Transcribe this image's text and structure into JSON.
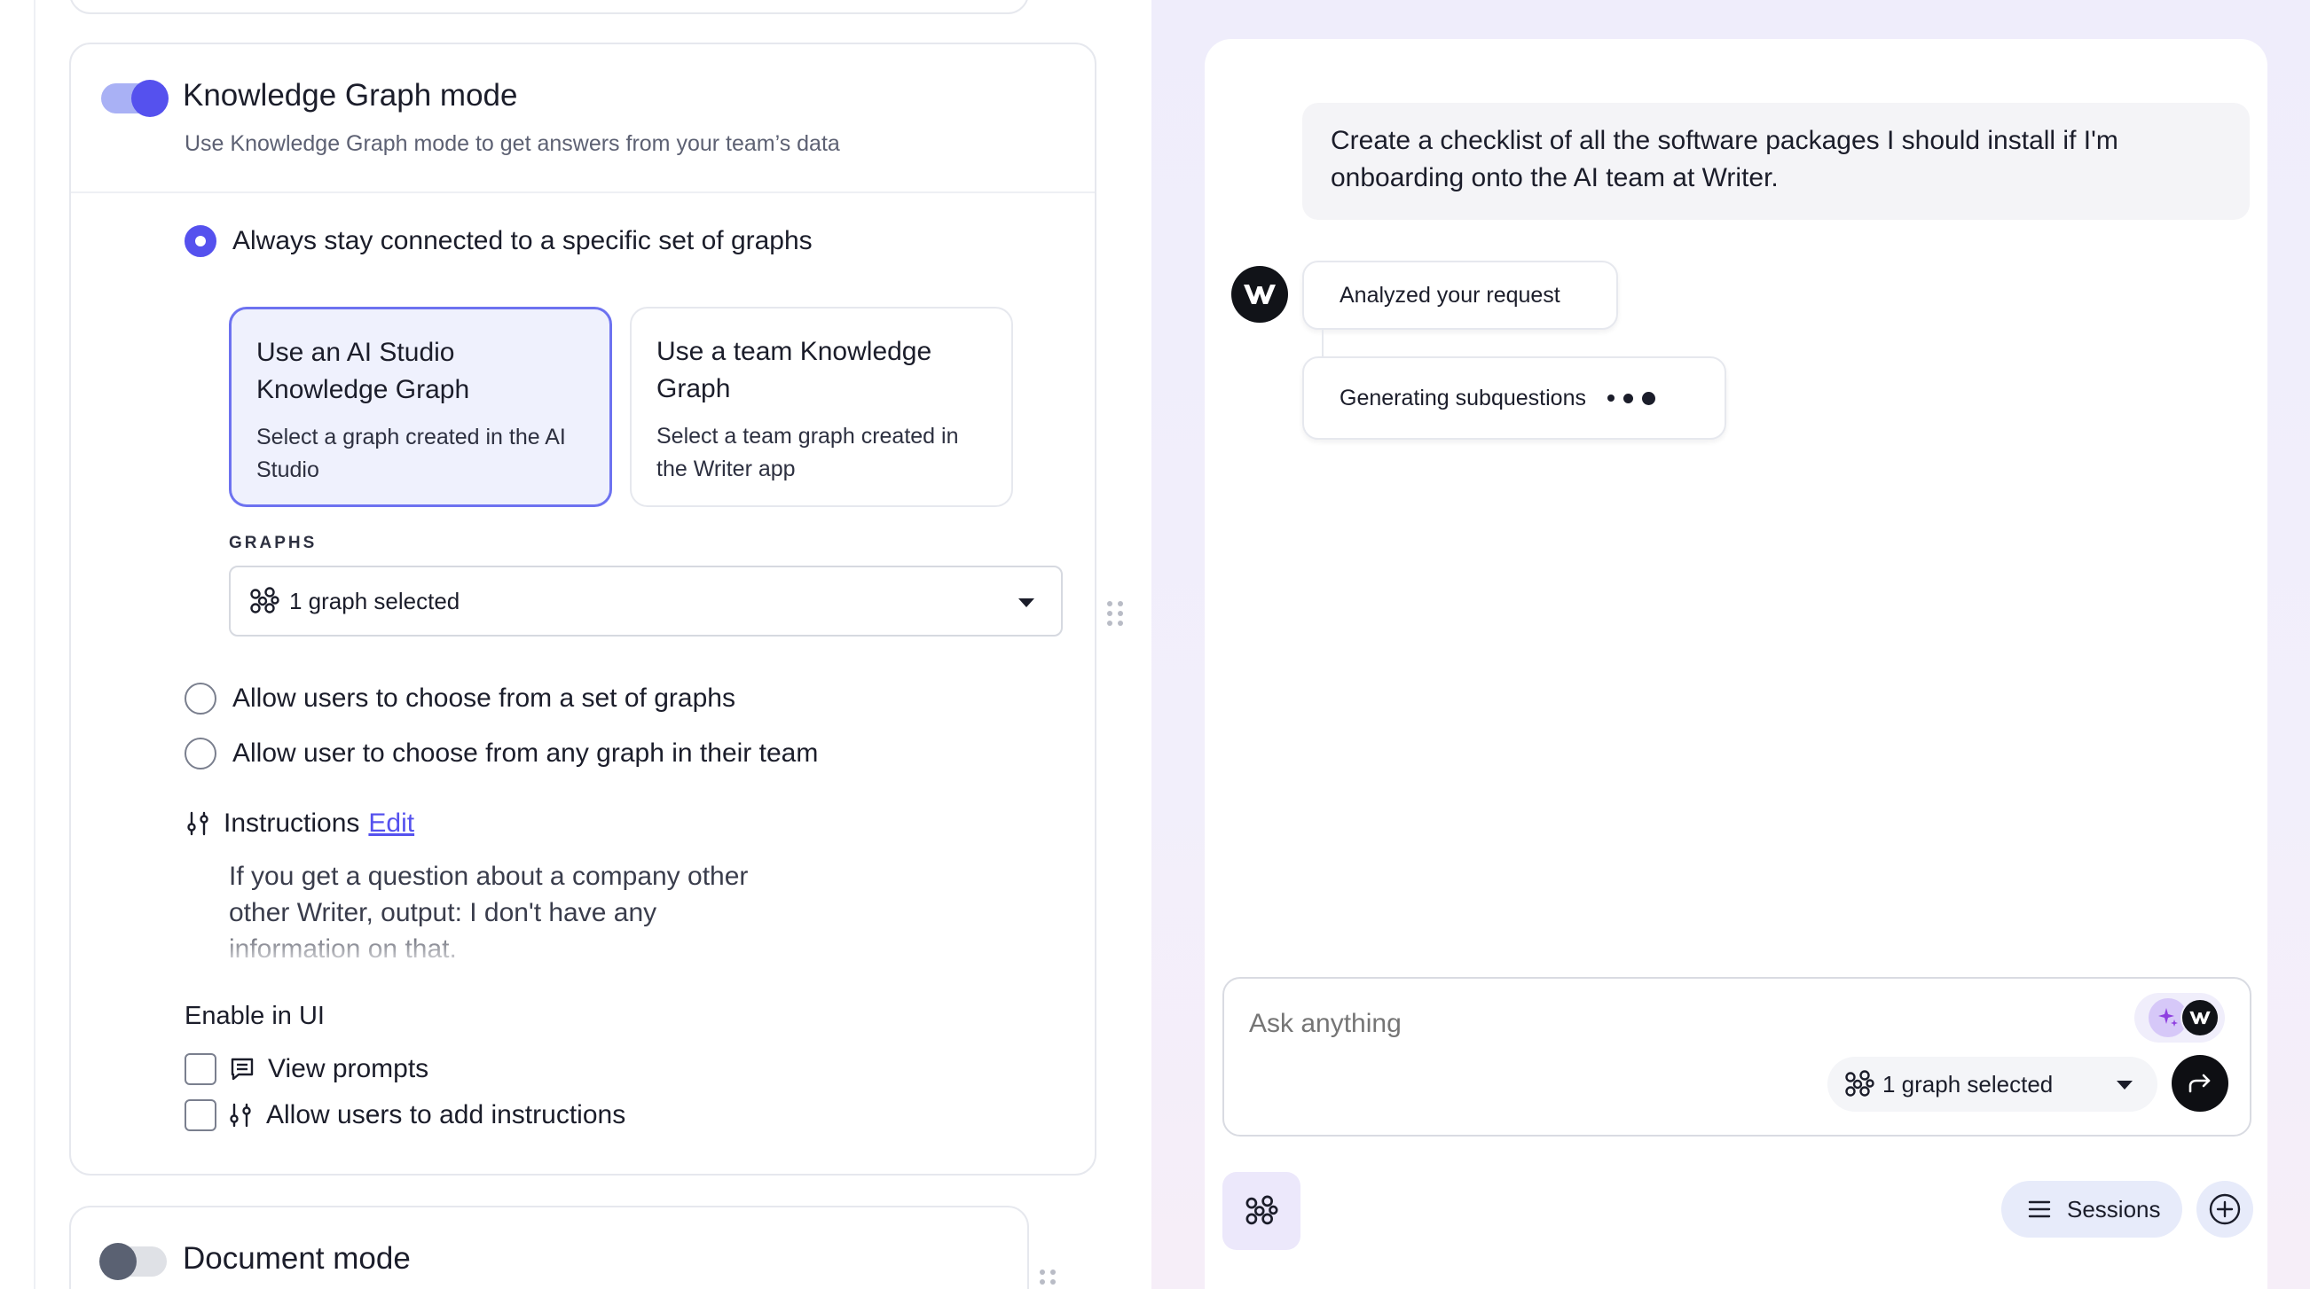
{
  "kg_mode": {
    "title": "Knowledge Graph mode",
    "description": "Use Knowledge Graph mode to get answers from your team’s data",
    "toggle_on": true,
    "options": [
      {
        "label": "Always stay connected to a specific set of graphs",
        "checked": true
      },
      {
        "label": "Allow users to choose from a set of graphs",
        "checked": false
      },
      {
        "label": "Allow user to choose from any graph in their team",
        "checked": false
      }
    ],
    "source_cards": [
      {
        "title": "Use an AI Studio Knowledge Graph",
        "description": "Select a graph created in the AI Studio",
        "selected": true
      },
      {
        "title": "Use a team Knowledge Graph",
        "description": "Select a team graph created in the Writer app",
        "selected": false
      }
    ],
    "graphs_label": "GRAPHS",
    "graphs_select_value": "1 graph selected",
    "instructions_label": "Instructions",
    "instructions_edit": "Edit",
    "instructions_text": "If you get a question about a company other other Writer, output: I don't have any information on that.",
    "enable_ui_label": "Enable in UI",
    "enable_ui_options": [
      {
        "label": "View prompts",
        "icon": "prompts-icon",
        "checked": false
      },
      {
        "label": "Allow users to add instructions",
        "icon": "sliders-icon",
        "checked": false
      }
    ]
  },
  "doc_mode": {
    "title": "Document mode",
    "toggle_on": false
  },
  "chat": {
    "user_message": "Create a checklist of all the software packages I should install if I'm onboarding onto the AI team at Writer.",
    "status_steps": [
      "Analyzed your request",
      "Generating subquestions"
    ],
    "composer_placeholder": "Ask anything",
    "graph_selector": "1 graph selected",
    "sessions_label": "Sessions"
  },
  "colors": {
    "accent": "#5551ee",
    "accent_light": "#eff1fd",
    "right_bg": "#efedfb",
    "dark": "#111318"
  }
}
